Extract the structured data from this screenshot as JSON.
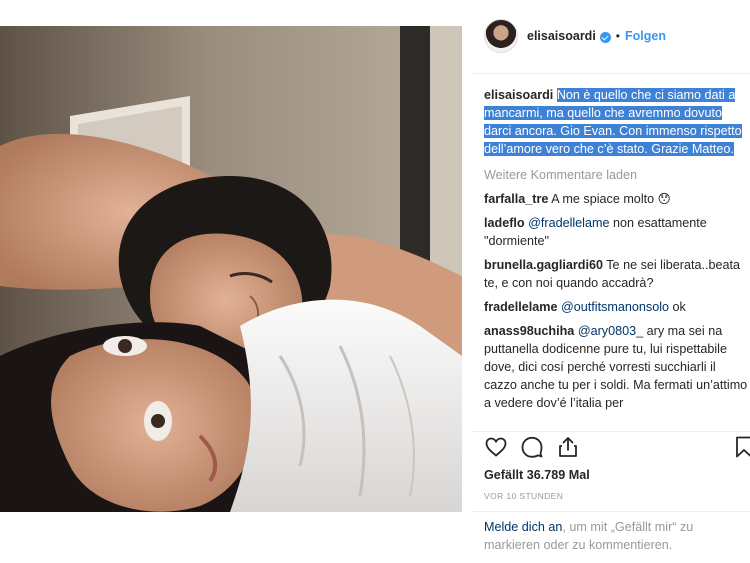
{
  "post": {
    "username": "elisaisoardi",
    "follow_label": "Folgen",
    "dot": "•"
  },
  "caption": {
    "user": "elisaisoardi",
    "text": "Non è quello che ci siamo dati a mancarmi, ma quello che avremmo dovuto darci ancora. Gio Evan. Con immenso rispetto dell’amore vero che c’è stato. Grazie Matteo."
  },
  "load_more_label": "Weitere Kommentare laden",
  "comments": [
    {
      "user": "farfalla_tre",
      "mention": "",
      "text": "A me spiace molto 😯"
    },
    {
      "user": "ladeflo",
      "mention": "@fradellelame",
      "text": "non esattamente \"dormiente\""
    },
    {
      "user": "brunella.gagliardi60",
      "mention": "",
      "text": "Te ne sei liberata..beata te, e con noi quando accadrà?"
    },
    {
      "user": "fradellelame",
      "mention": "@outfitsmanonsolo",
      "text": "ok"
    },
    {
      "user": "anass98uchiha",
      "mention": "@ary0803_",
      "text": "ary ma sei na puttanella dodicenne pure tu, lui rispettabile dove, dici cosí perché vorresti succhiarli il cazzo anche tu per i soldi. Ma fermati un’attimo a vedere dov’é l’italia per"
    }
  ],
  "likes_text": "Gefällt 36.789 Mal",
  "time_text": "VOR 10 STUNDEN",
  "login_prompt": {
    "link": "Melde dich an",
    "text": ", um mit „Gefällt mir“ zu markieren oder zu kommentieren."
  },
  "icons": {
    "like": "heart-icon",
    "comment": "comment-bubble-icon",
    "share": "share-icon",
    "save": "bookmark-icon"
  },
  "colors": {
    "link_blue": "#3897f0",
    "caption_highlight": "#3d82d6",
    "muted": "#999999"
  }
}
